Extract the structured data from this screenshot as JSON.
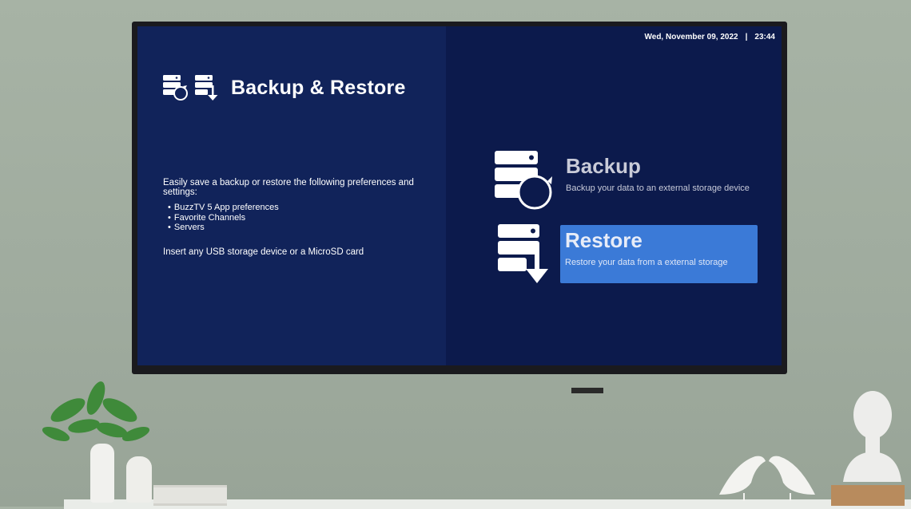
{
  "header": {
    "title": "Backup & Restore",
    "date": "Wed, November 09, 2022",
    "separator": "|",
    "time": "23:44"
  },
  "info": {
    "intro": "Easily save a backup or restore the following preferences and settings:",
    "items": [
      "BuzzTV 5 App preferences",
      "Favorite Channels",
      "Servers"
    ],
    "note": "Insert any USB storage device or a MicroSD card"
  },
  "options": {
    "backup": {
      "title": "Backup",
      "description": "Backup your data to an external storage device",
      "icon": "database-refresh-icon"
    },
    "restore": {
      "title": "Restore",
      "description": "Restore your data from a external storage",
      "icon": "database-download-icon",
      "selected": true
    }
  },
  "colors": {
    "left_panel": "#11235a",
    "right_panel": "#0c1a4c",
    "selection": "#3b7ad7"
  }
}
